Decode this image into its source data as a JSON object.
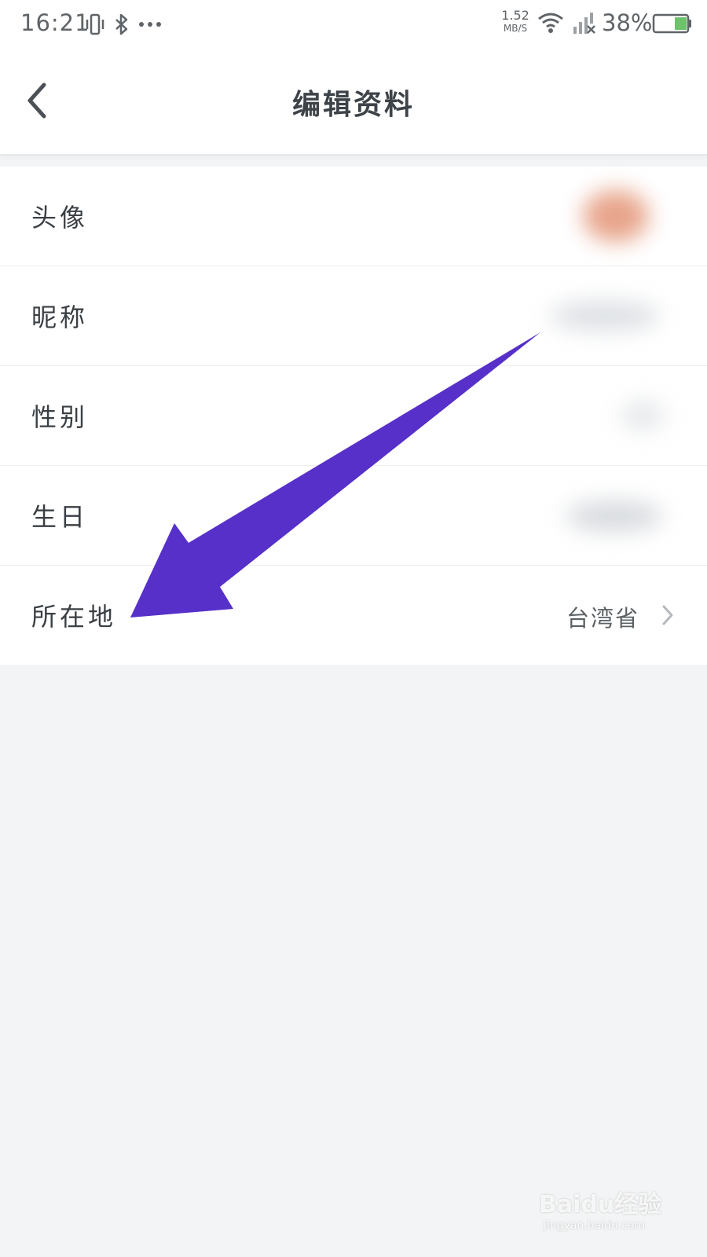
{
  "status_bar": {
    "time": "16:21",
    "net_speed_value": "1.52",
    "net_speed_unit": "MB/S",
    "battery_percent": "38%",
    "battery_level": 0.38,
    "icons": [
      "vibrate-icon",
      "bluetooth-icon",
      "more-dots-icon",
      "wifi-icon",
      "signal-no-service-icon",
      "battery-icon"
    ]
  },
  "header": {
    "title": "编辑资料",
    "back_icon": "chevron-left-icon"
  },
  "profile_rows": [
    {
      "label": "头像"
    },
    {
      "label": "昵称"
    },
    {
      "label": "性别"
    },
    {
      "label": "生日"
    },
    {
      "label": "所在地",
      "value": "台湾省"
    }
  ],
  "annotation": {
    "type": "arrow",
    "color": "#5630c8"
  },
  "watermark": {
    "main": "Baidu经验",
    "sub": "jingyan.baidu.com"
  }
}
